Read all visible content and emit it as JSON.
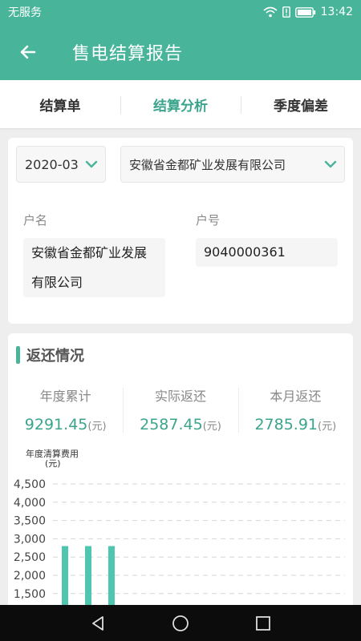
{
  "status": {
    "carrier": "无服务",
    "time": "13:42"
  },
  "appbar": {
    "title": "售电结算报告"
  },
  "tabs": [
    {
      "label": "结算单",
      "active": false
    },
    {
      "label": "结算分析",
      "active": true
    },
    {
      "label": "季度偏差",
      "active": false
    }
  ],
  "filters": {
    "month": "2020-03",
    "company": "安徽省金都矿业发展有限公司"
  },
  "account": {
    "name_label": "户名",
    "name_line1": "安徽省金都矿业发展",
    "name_line2": "有限公司",
    "number_label": "户号",
    "number": "9040000361"
  },
  "rebate": {
    "title": "返还情况",
    "unit": "(元)",
    "stats": [
      {
        "label": "年度累计",
        "value": "9291.45"
      },
      {
        "label": "实际返还",
        "value": "2587.45"
      },
      {
        "label": "本月返还",
        "value": "2785.91"
      }
    ]
  },
  "chart_data": {
    "type": "bar",
    "title": "",
    "ylabel": "年度清算费用",
    "yunit": "(元)",
    "ylim": [
      1500,
      4500
    ],
    "yticks": [
      "4,500",
      "4,000",
      "3,500",
      "3,000",
      "2,500",
      "2,000",
      "1,500"
    ],
    "categories": [
      "",
      "",
      ""
    ],
    "values": [
      2800,
      2800,
      2800
    ],
    "grid": true,
    "bar_color": "#4fc7b0"
  },
  "colors": {
    "primary": "#48b59b",
    "accent_text": "#3aa58c"
  }
}
